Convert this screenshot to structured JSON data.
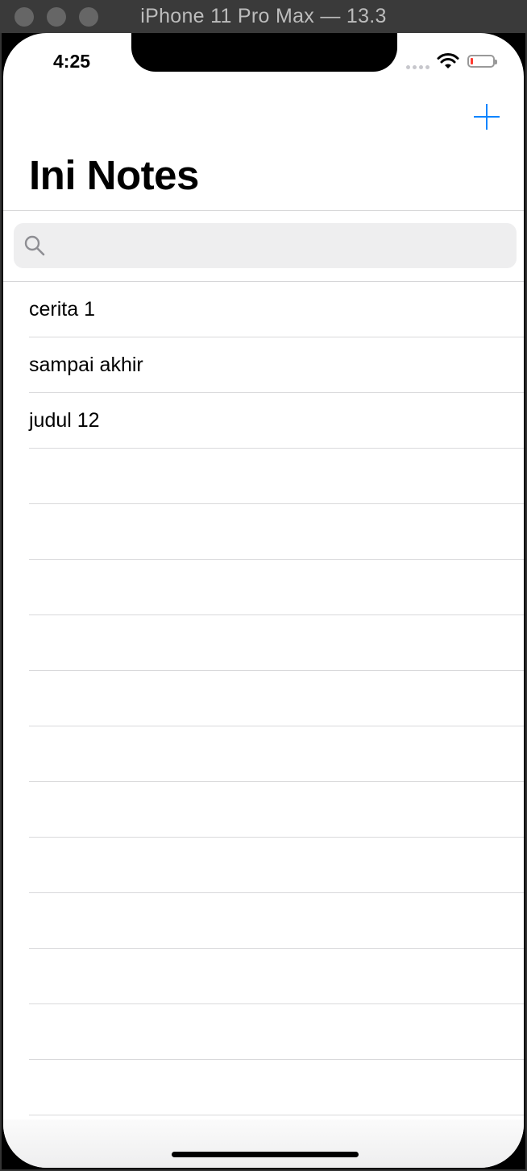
{
  "window": {
    "title": "iPhone 11 Pro Max — 13.3"
  },
  "status_bar": {
    "time": "4:25",
    "battery_level": 0.1
  },
  "nav": {
    "large_title": "Ini Notes",
    "add_icon": "plus-icon"
  },
  "search": {
    "placeholder": "",
    "value": "",
    "icon": "magnifier-icon"
  },
  "notes": [
    {
      "title": "cerita 1"
    },
    {
      "title": "sampai akhir"
    },
    {
      "title": "judul 12"
    }
  ],
  "empty_rows": 12,
  "colors": {
    "accent": "#0a84ff",
    "search_bg": "#eeeeef",
    "separator": "#d9d9db",
    "battery_low": "#ff3b30"
  }
}
